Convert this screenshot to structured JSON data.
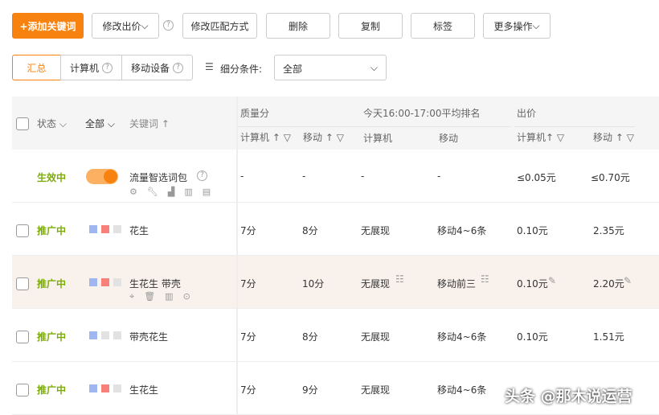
{
  "toolbar": {
    "add": "+添加关键词",
    "edit_bid": "修改出价",
    "edit_match": "修改匹配方式",
    "delete": "删除",
    "copy": "复制",
    "tag": "标签",
    "more": "更多操作"
  },
  "segments": {
    "summary": "汇总",
    "computer": "计算机",
    "mobile": "移动设备",
    "filter_label": "细分条件:",
    "filter_value": "全部"
  },
  "header": {
    "status": "状态",
    "all": "全部",
    "keyword": "关键词",
    "quality": "质量分",
    "rank": "今天16:00-17:00平均排名",
    "bid": "出价",
    "computer": "计算机",
    "mobile": "移动"
  },
  "colors": {
    "accent": "#f7820f",
    "status_green": "#7cab0a",
    "blue": "#9fb6f0",
    "red": "#f7817a",
    "gray": "#e2e2e2"
  },
  "rows": [
    {
      "status": "生效中",
      "keyword": "流量智选词包",
      "q_pc": "-",
      "q_m": "-",
      "r_pc": "-",
      "r_m": "-",
      "b_pc": "≤0.05元",
      "b_m": "≤0.70元"
    },
    {
      "status": "推广中",
      "keyword": "花生",
      "q_pc": "7分",
      "q_m": "8分",
      "r_pc": "无展现",
      "r_m": "移动4~6条",
      "b_pc": "0.10元",
      "b_m": "2.35元"
    },
    {
      "status": "推广中",
      "keyword": "生花生 带壳",
      "q_pc": "7分",
      "q_m": "10分",
      "r_pc": "无展现",
      "r_m": "移动前三",
      "b_pc": "0.10元",
      "b_m": "2.20元"
    },
    {
      "status": "推广中",
      "keyword": "带壳花生",
      "q_pc": "7分",
      "q_m": "8分",
      "r_pc": "无展现",
      "r_m": "移动4~6条",
      "b_pc": "0.10元",
      "b_m": "1.51元"
    },
    {
      "status": "推广中",
      "keyword": "生花生",
      "q_pc": "7分",
      "q_m": "9分",
      "r_pc": "无展现",
      "r_m": "移动4~6条",
      "b_pc": "",
      "b_m": ""
    }
  ],
  "watermark": "头条 @那木说运营"
}
